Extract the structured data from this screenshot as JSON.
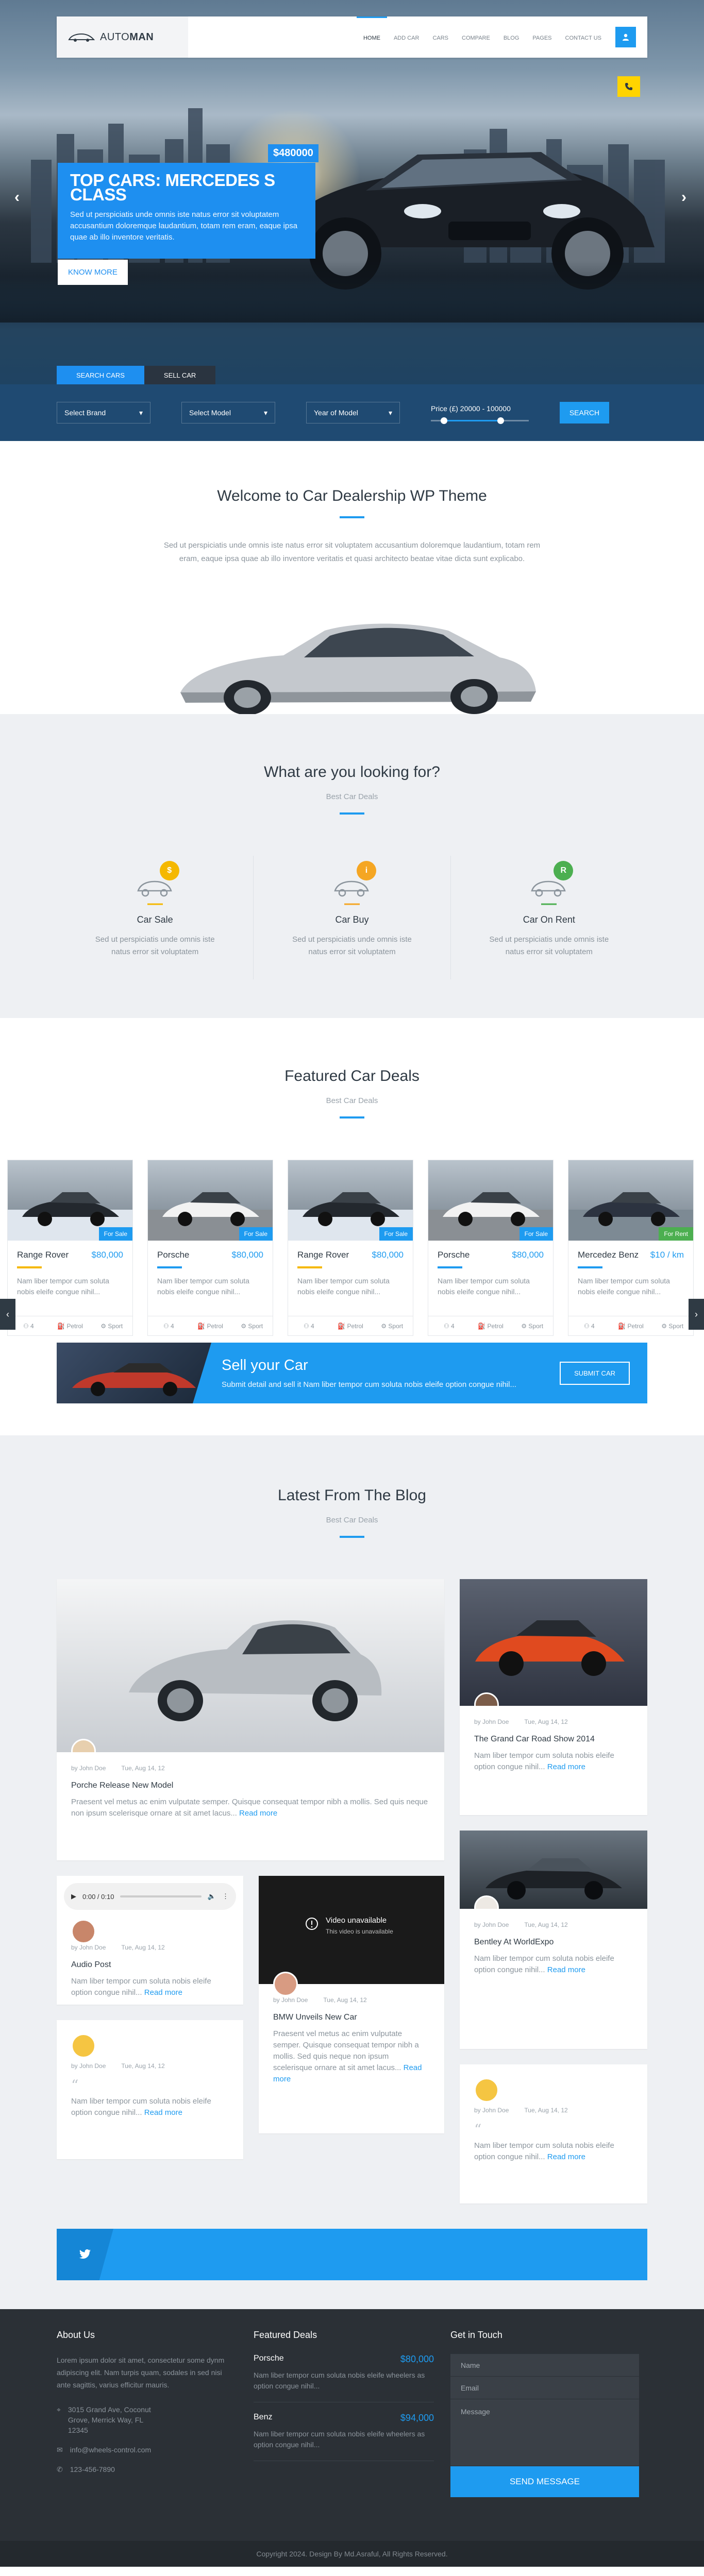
{
  "header": {
    "logo": "AUTO",
    "logo_bold": "MAN",
    "nav": [
      "HOME",
      "ADD CAR",
      "CARS",
      "COMPARE",
      "BLOG",
      "PAGES",
      "CONTACT US"
    ]
  },
  "hero": {
    "price": "$480000",
    "title": "TOP CARS: MERCEDES S CLASS",
    "text": "Sed ut perspiciatis unde omnis iste natus error sit voluptatem accusantium doloremque laudantium, totam rem eram, eaque ipsa quae ab illo inventore veritatis.",
    "button": "KNOW MORE",
    "prev": "‹",
    "next": "›"
  },
  "search": {
    "tabs": [
      "SEARCH CARS",
      "SELL CAR"
    ],
    "brand": "Select Brand",
    "model": "Select Model",
    "year": "Year of Model",
    "price_label": "Price (£) 20000 - 100000",
    "button": "SEARCH",
    "price_min": 20000,
    "price_max": 100000
  },
  "welcome": {
    "title": "Welcome to Car Dealership WP Theme",
    "text": "Sed ut perspiciatis unde omnis iste natus error sit voluptatem accusantium doloremque laudantium, totam rem eram, eaque ipsa quae ab illo inventore veritatis et quasi architecto beatae vitae dicta sunt explicabo."
  },
  "looking": {
    "title": "What are you looking for?",
    "subtitle": "Best Car Deals",
    "items": [
      {
        "title": "Car Sale",
        "text": "Sed ut perspiciatis unde omnis iste natus error sit voluptatem",
        "badge": "$",
        "color": "#f5b800"
      },
      {
        "title": "Car Buy",
        "text": "Sed ut perspiciatis unde omnis iste natus error sit voluptatem",
        "badge": "i",
        "color": "#f5a623"
      },
      {
        "title": "Car On Rent",
        "text": "Sed ut perspiciatis unde omnis iste natus error sit voluptatem",
        "badge": "R",
        "color": "#4caf50"
      }
    ]
  },
  "featured": {
    "title": "Featured Car Deals",
    "subtitle": "Best Car Deals",
    "deals": [
      {
        "name": "Range Rover",
        "price": "$80,000",
        "badge": "For Sale",
        "desc": "Nam liber tempor cum soluta nobis eleife congue nihil...",
        "f1": "4",
        "f2": "Petrol",
        "f3": "Sport",
        "line": "#f5b800"
      },
      {
        "name": "Porsche",
        "price": "$80,000",
        "badge": "For Sale",
        "desc": "Nam liber tempor cum soluta nobis eleife congue nihil...",
        "f1": "4",
        "f2": "Petrol",
        "f3": "Sport",
        "line": "#1e9bf0"
      },
      {
        "name": "Range Rover",
        "price": "$80,000",
        "badge": "For Sale",
        "desc": "Nam liber tempor cum soluta nobis eleife congue nihil...",
        "f1": "4",
        "f2": "Petrol",
        "f3": "Sport",
        "line": "#f5b800"
      },
      {
        "name": "Porsche",
        "price": "$80,000",
        "badge": "For Sale",
        "desc": "Nam liber tempor cum soluta nobis eleife congue nihil...",
        "f1": "4",
        "f2": "Petrol",
        "f3": "Sport",
        "line": "#1e9bf0"
      },
      {
        "name": "Mercedez Benz",
        "price": "$10 / km",
        "badge": "For Rent",
        "desc": "Nam liber tempor cum soluta nobis eleife congue nihil...",
        "f1": "4",
        "f2": "Petrol",
        "f3": "Sport",
        "line": "#1e9bf0"
      }
    ]
  },
  "sell": {
    "title": "Sell your Car",
    "text": "Submit detail and sell it Nam liber tempor cum soluta nobis eleife option congue nihil...",
    "button": "SUBMIT CAR"
  },
  "blog": {
    "title": "Latest From The Blog",
    "subtitle": "Best Car Deals",
    "read_more": "Read more",
    "posts": [
      {
        "author": "by John Doe",
        "date": "Tue, Aug 14, 12",
        "title": "Porche Release New Model",
        "text": "Praesent vel metus ac enim vulputate semper. Quisque consequat tempor nibh a mollis. Sed quis neque non ipsum scelerisque ornare at sit amet lacus..."
      },
      {
        "author": "by John Doe",
        "date": "Tue, Aug 14, 12",
        "title": "The Grand Car Road Show 2014",
        "text": "Nam liber tempor cum soluta nobis eleife option congue nihil..."
      },
      {
        "author": "by John Doe",
        "date": "Tue, Aug 14, 12",
        "title": "Audio Post",
        "text": "Nam liber tempor cum soluta nobis eleife option congue nihil...",
        "audio": "0:00 / 0:10"
      },
      {
        "author": "by John Doe",
        "date": "Tue, Aug 14, 12",
        "title": "BMW Unveils New Car",
        "text": "Praesent vel metus ac enim vulputate semper. Quisque consequat tempor nibh a mollis. Sed quis neque non ipsum scelerisque ornare at sit amet lacus...",
        "video_title": "Video unavailable",
        "video_sub": "This video is unavailable"
      },
      {
        "author": "by John Doe",
        "date": "Tue, Aug 14, 12",
        "title": "Bentley At WorldExpo",
        "text": "Nam liber tempor cum soluta nobis eleife option congue nihil..."
      },
      {
        "author": "by John Doe",
        "date": "Tue, Aug 14, 12",
        "text": "Nam liber tempor cum soluta nobis eleife option congue nihil..."
      },
      {
        "author": "by John Doe",
        "date": "Tue, Aug 14, 12",
        "text": "Nam liber tempor cum soluta nobis eleife option congue nihil..."
      }
    ]
  },
  "footer": {
    "about_title": "About Us",
    "about_text": "Lorem ipsum dolor sit amet, consectetur some dynm adipiscing elit. Nam turpis quam, sodales in sed nisi ante sagittis, varius efficitur mauris.",
    "address": "3015 Grand Ave, Coconut Grove, Merrick Way, FL 12345",
    "email": "info@wheels-control.com",
    "phone": "123-456-7890",
    "deals_title": "Featured Deals",
    "deals": [
      {
        "name": "Porsche",
        "price": "$80,000",
        "text": "Nam liber tempor cum soluta nobis eleife wheelers as option congue nihil..."
      },
      {
        "name": "Benz",
        "price": "$94,000",
        "text": "Nam liber tempor cum soluta nobis eleife wheelers as option congue nihil..."
      }
    ],
    "contact_title": "Get in Touch",
    "name_ph": "Name",
    "email_ph": "Email",
    "msg_ph": "Message",
    "send": "SEND MESSAGE",
    "copyright": "Copyright 2024. Design By Md.Asraful, All Rights Reserved."
  }
}
